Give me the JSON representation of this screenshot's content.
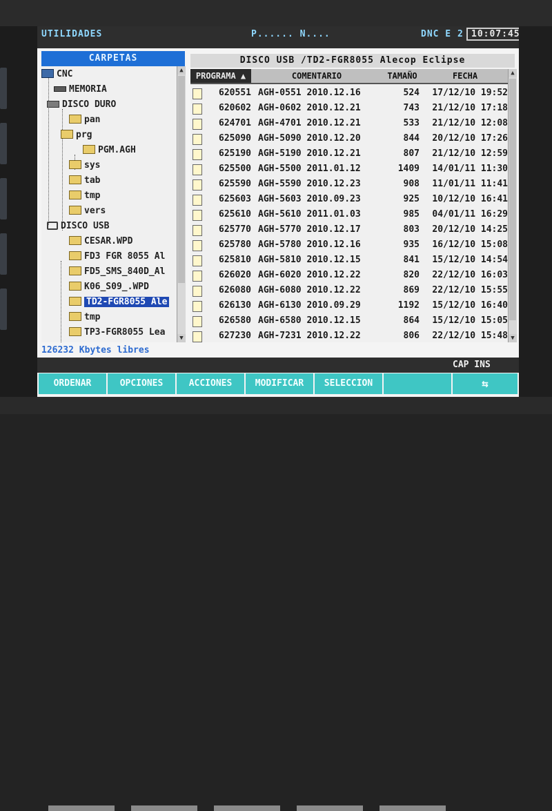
{
  "topbar": {
    "title": "UTILIDADES",
    "program": "P...... N....",
    "dnc": "DNC E 2",
    "time": "10:07:45"
  },
  "folders": {
    "header": "CARPETAS",
    "items": [
      {
        "label": "CNC",
        "icon": "pc-icon"
      },
      {
        "label": "MEMORIA",
        "icon": "chip-icon"
      },
      {
        "label": "DISCO DURO",
        "icon": "drive-icon"
      },
      {
        "label": "pan",
        "icon": "folder-icon"
      },
      {
        "label": "prg",
        "icon": "folder-icon"
      },
      {
        "label": "PGM.AGH",
        "icon": "folder-icon"
      },
      {
        "label": "sys",
        "icon": "folder-icon"
      },
      {
        "label": "tab",
        "icon": "folder-icon"
      },
      {
        "label": "tmp",
        "icon": "folder-icon"
      },
      {
        "label": "vers",
        "icon": "folder-icon"
      },
      {
        "label": "DISCO USB",
        "icon": "usb-icon"
      },
      {
        "label": "CESAR.WPD",
        "icon": "folder-icon"
      },
      {
        "label": "FD3 FGR 8055 Al",
        "icon": "folder-icon"
      },
      {
        "label": "FD5_SMS_840D_Al",
        "icon": "folder-icon"
      },
      {
        "label": "K06_S09_.WPD",
        "icon": "folder-icon"
      },
      {
        "label": "TD2-FGR8055 Ale",
        "icon": "folder-icon",
        "selected": true
      },
      {
        "label": "tmp",
        "icon": "folder-icon"
      },
      {
        "label": "TP3-FGR8055 Lea",
        "icon": "folder-icon"
      }
    ],
    "footer": "126232 Kbytes libres"
  },
  "files": {
    "path": "DISCO USB /TD2-FGR8055 Alecop Eclipse",
    "columns": {
      "programa": "PROGRAMA",
      "comentario": "COMENTARIO",
      "tamano": "TAMAÑO",
      "fecha": "FECHA"
    },
    "rows": [
      {
        "programa": "620551",
        "comentario": "AGH-0551 2010.12.16",
        "tamano": "524",
        "fecha": "17/12/10 19:52"
      },
      {
        "programa": "620602",
        "comentario": "AGH-0602 2010.12.21",
        "tamano": "743",
        "fecha": "21/12/10 17:18"
      },
      {
        "programa": "624701",
        "comentario": "AGH-4701 2010.12.21",
        "tamano": "533",
        "fecha": "21/12/10 12:08"
      },
      {
        "programa": "625090",
        "comentario": "AGH-5090 2010.12.20",
        "tamano": "844",
        "fecha": "20/12/10 17:26"
      },
      {
        "programa": "625190",
        "comentario": "AGH-5190 2010.12.21",
        "tamano": "807",
        "fecha": "21/12/10 12:59"
      },
      {
        "programa": "625500",
        "comentario": "AGH-5500 2011.01.12",
        "tamano": "1409",
        "fecha": "14/01/11 11:30"
      },
      {
        "programa": "625590",
        "comentario": "AGH-5590 2010.12.23",
        "tamano": "908",
        "fecha": "11/01/11 11:41"
      },
      {
        "programa": "625603",
        "comentario": "AGH-5603 2010.09.23",
        "tamano": "925",
        "fecha": "10/12/10 16:41"
      },
      {
        "programa": "625610",
        "comentario": "AGH-5610 2011.01.03",
        "tamano": "985",
        "fecha": "04/01/11 16:29"
      },
      {
        "programa": "625770",
        "comentario": "AGH-5770 2010.12.17",
        "tamano": "803",
        "fecha": "20/12/10 14:25"
      },
      {
        "programa": "625780",
        "comentario": "AGH-5780 2010.12.16",
        "tamano": "935",
        "fecha": "16/12/10 15:08"
      },
      {
        "programa": "625810",
        "comentario": "AGH-5810 2010.12.15",
        "tamano": "841",
        "fecha": "15/12/10 14:54"
      },
      {
        "programa": "626020",
        "comentario": "AGH-6020 2010.12.22",
        "tamano": "820",
        "fecha": "22/12/10 16:03"
      },
      {
        "programa": "626080",
        "comentario": "AGH-6080 2010.12.22",
        "tamano": "869",
        "fecha": "22/12/10 15:55"
      },
      {
        "programa": "626130",
        "comentario": "AGH-6130 2010.09.29",
        "tamano": "1192",
        "fecha": "15/12/10 16:40"
      },
      {
        "programa": "626580",
        "comentario": "AGH-6580 2010.12.15",
        "tamano": "864",
        "fecha": "15/12/10 15:05"
      },
      {
        "programa": "627230",
        "comentario": "AGH-7231 2010.12.22",
        "tamano": "806",
        "fecha": "22/12/10 15:48"
      }
    ]
  },
  "status": {
    "indicator": "CAP INS"
  },
  "softkeys": {
    "ordenar": "ORDENAR",
    "opciones": "OPCIONES",
    "acciones": "ACCIONES",
    "modificar": "MODIFICAR",
    "seleccion": "SELECCION",
    "swap_icon": "⇆"
  },
  "colors": {
    "softkey": "#3fc6c4",
    "header_blue": "#1e6fd6",
    "selection": "#1f49b3",
    "topbar_text": "#8fd8ff"
  }
}
